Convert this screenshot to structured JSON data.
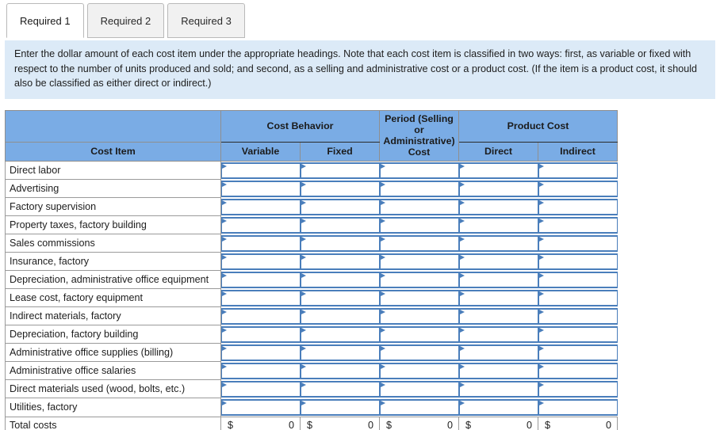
{
  "tabs": [
    {
      "label": "Required 1",
      "active": true
    },
    {
      "label": "Required 2",
      "active": false
    },
    {
      "label": "Required 3",
      "active": false
    }
  ],
  "instructions": {
    "text": "Enter the dollar amount of each cost item under the appropriate headings. Note that each cost item is classified in two ways: first, as variable or fixed with respect to the number of units produced and sold; and second, as a selling and administrative cost or a product cost. (If the item is a product cost, it should also be classified as either direct or indirect.)"
  },
  "table": {
    "group_headers": {
      "blank": "",
      "cost_behavior": "Cost Behavior",
      "period_cost": "Period (Selling or Administrative) Cost",
      "product_cost": "Product Cost"
    },
    "sub_headers": {
      "cost_item": "Cost Item",
      "variable": "Variable",
      "fixed": "Fixed",
      "direct": "Direct",
      "indirect": "Indirect"
    },
    "rows": [
      {
        "label": "Direct labor"
      },
      {
        "label": "Advertising"
      },
      {
        "label": "Factory supervision"
      },
      {
        "label": "Property taxes, factory building"
      },
      {
        "label": "Sales commissions"
      },
      {
        "label": "Insurance, factory"
      },
      {
        "label": "Depreciation, administrative office equipment"
      },
      {
        "label": "Lease cost, factory equipment"
      },
      {
        "label": "Indirect materials, factory"
      },
      {
        "label": "Depreciation, factory building"
      },
      {
        "label": "Administrative office supplies (billing)"
      },
      {
        "label": "Administrative office salaries"
      },
      {
        "label": "Direct materials used (wood, bolts, etc.)"
      },
      {
        "label": "Utilities, factory"
      }
    ],
    "total_row": {
      "label": "Total costs",
      "currency_symbol": "$",
      "values": [
        "0",
        "0",
        "0",
        "0",
        "0"
      ]
    },
    "input_values": [
      "",
      "",
      "",
      "",
      ""
    ]
  },
  "colors": {
    "header_blue": "#7aace5",
    "panel_blue": "#dceaf7",
    "input_border": "#4a7ebb",
    "tab_inactive": "#f1f1f1"
  }
}
